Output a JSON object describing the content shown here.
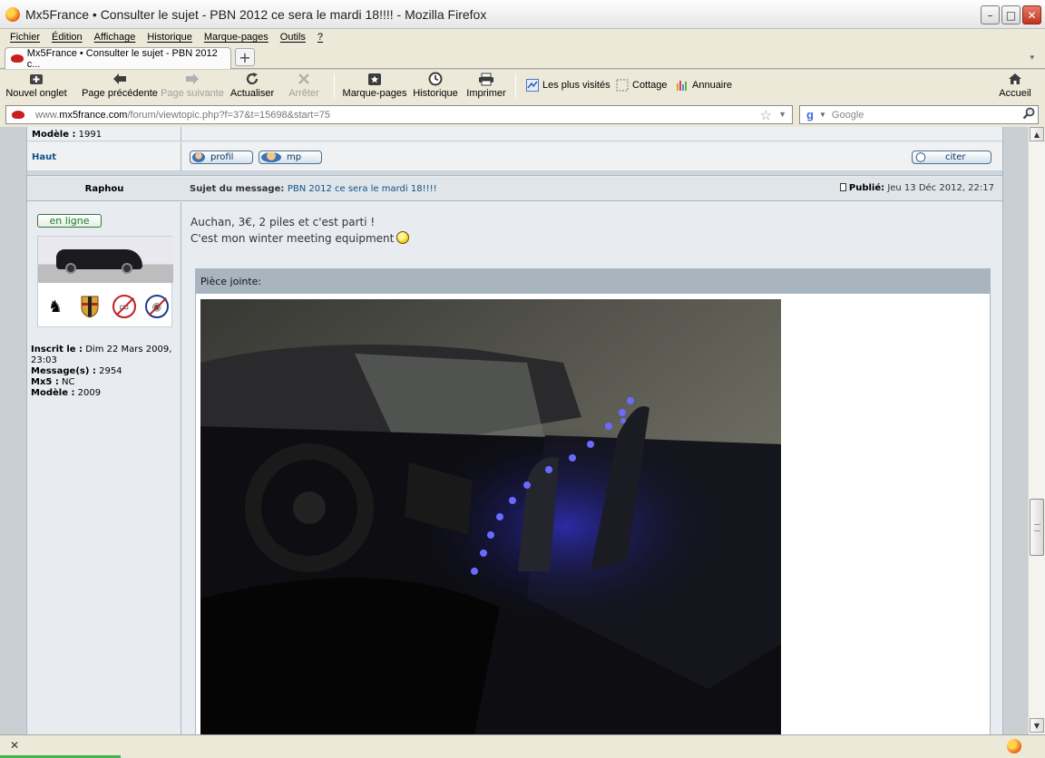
{
  "window": {
    "title": "Mx5France • Consulter le sujet - PBN 2012 ce sera le mardi 18!!!! - Mozilla Firefox",
    "minimize": "–",
    "maximize": "□",
    "close": "✕"
  },
  "menu": [
    "Fichier",
    "Édition",
    "Affichage",
    "Historique",
    "Marque-pages",
    "Outils",
    "?"
  ],
  "tab": {
    "label": "Mx5France • Consulter le sujet - PBN 2012 c...",
    "new_tab": "+",
    "dropdown": "▾"
  },
  "toolbar": {
    "new_tab": "Nouvel onglet",
    "back": "Page précédente",
    "forward": "Page suivante",
    "reload": "Actualiser",
    "stop": "Arrêter",
    "bookmarks": "Marque-pages",
    "history": "Historique",
    "print": "Imprimer",
    "most_visited": "Les plus visités",
    "cottage": "Cottage",
    "directory": "Annuaire",
    "home": "Accueil"
  },
  "url": {
    "prefix": "www.",
    "host": "mx5france.com",
    "path": "/forum/viewtopic.php?f=37&t=15698&start=75"
  },
  "search": {
    "placeholder": "Google"
  },
  "previous_post": {
    "model_label": "Modèle :",
    "model_value": "1991",
    "top_link": "Haut",
    "profile_button": "profil",
    "pm_button": "mp",
    "quote_button": "citer"
  },
  "post": {
    "author": "Raphou",
    "subject_label": "Sujet du message:",
    "subject": "PBN 2012 ce sera le mardi 18!!!!",
    "posted_label": "Publié:",
    "posted_date": "Jeu 13 Déc 2012, 22:17",
    "online_badge": "en ligne",
    "joined_label": "Inscrit le :",
    "joined_value": "Dim 22 Mars 2009, 23:03",
    "messages_label": "Message(s) :",
    "messages_value": "2954",
    "mx5_label": "Mx5 :",
    "mx5_value": "NC",
    "model_label": "Modèle :",
    "model_value": "2009",
    "body_line1": "Auchan, 3€, 2 piles et c'est parti !",
    "body_line2": "C'est mon winter meeting equipment",
    "attachment_label": "Pièce jointe:"
  },
  "statusbar": {
    "close": "✕",
    "progress": 0.12
  },
  "colors": {
    "link": "#105289",
    "online": "#1f7a2e",
    "led_blue": "#3a3aff"
  }
}
